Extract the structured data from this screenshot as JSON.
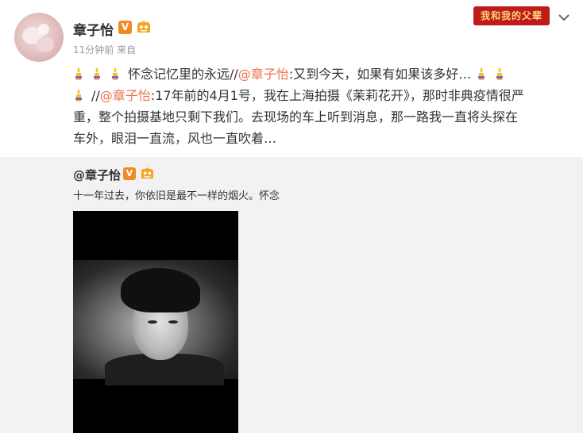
{
  "post": {
    "author": "章子怡",
    "vip_mark": "V",
    "meta": "11分钟前 来自",
    "campaign_badge": "我和我的父辈",
    "line1_text": "怀念记忆里的永远//",
    "line1_mention": "@章子怡",
    "line1_rest": ":又到今天，如果有如果该多好…",
    "line2_prefix": "//",
    "line2_mention": "@章子怡",
    "line2_rest": ":17年前的4月1号，我在上海拍摄《茉莉花开》，那时非典疫情很严",
    "line3": "重，整个拍摄基地只剩下我们。去现场的车上听到消息，那一路我一直将头探在",
    "line4": "车外，眼泪一直流，风也一直吹着…"
  },
  "repost": {
    "author": "@章子怡",
    "vip_mark": "V",
    "text": "十一年过去，你依旧是最不一样的烟火。怀念"
  },
  "colors": {
    "mention": "#eb7350",
    "vip": "#f08a24",
    "candle": "#f1c232",
    "candle_ribbon": "#8e5cc9",
    "repost_bg": "#f2f2f2"
  },
  "icons": [
    "candle-icon",
    "vip-badge-icon",
    "fan-badge-icon",
    "chevron-down-icon"
  ]
}
